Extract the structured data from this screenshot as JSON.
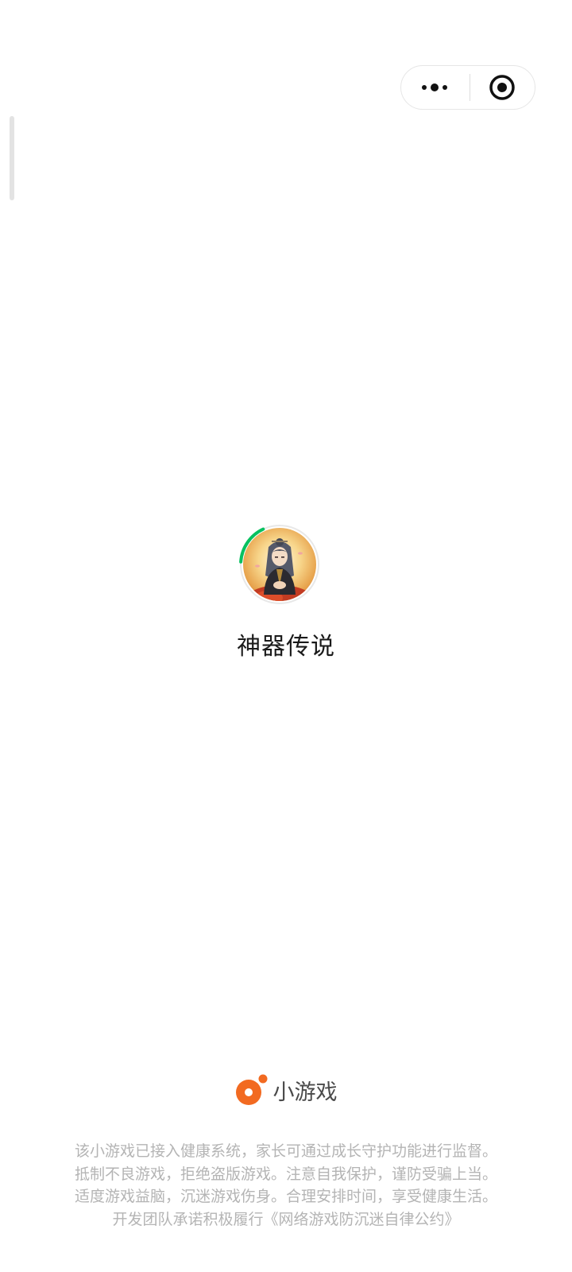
{
  "capsule": {
    "more_icon": "more-dots-icon",
    "close_icon": "target-close-icon"
  },
  "loading": {
    "game_name": "神器传说",
    "avatar_icon": "game-character-avatar",
    "progress_fraction": 0.17,
    "progress_color": "#07C160"
  },
  "brand": {
    "label": "小游戏",
    "logo_icon": "mini-game-logo-icon",
    "logo_color": "#F26A21"
  },
  "notice": {
    "lines": [
      "该小游戏已接入健康系统，家长可通过成长守护功能进行监督。",
      "抵制不良游戏，拒绝盗版游戏。注意自我保护，谨防受骗上当。",
      "适度游戏益脑，沉迷游戏伤身。合理安排时间，享受健康生活。",
      "开发团队承诺积极履行《网络游戏防沉迷自律公约》"
    ]
  }
}
